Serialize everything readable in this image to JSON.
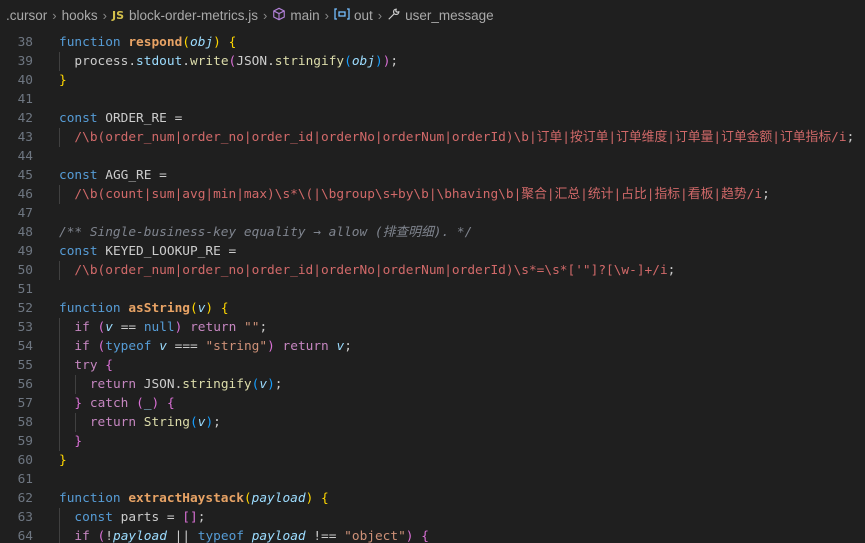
{
  "breadcrumb": {
    "folder": ".cursor",
    "subfolder": "hooks",
    "file_badge": "JS",
    "file": "block-order-metrics.js",
    "symbol1": "main",
    "symbol2": "out",
    "symbol3": "user_message"
  },
  "lines": [
    {
      "n": "38",
      "tokens": [
        [
          "k",
          "function "
        ],
        [
          "bold-fn",
          "respond"
        ],
        [
          "y",
          "("
        ],
        [
          "p",
          "obj"
        ],
        [
          "y",
          ")"
        ],
        [
          "w",
          " "
        ],
        [
          "y",
          "{"
        ]
      ]
    },
    {
      "n": "39",
      "tokens": [
        [
          "w",
          "  process."
        ],
        [
          "v",
          "stdout"
        ],
        [
          "w",
          "."
        ],
        [
          "f",
          "write"
        ],
        [
          "pk",
          "("
        ],
        [
          "w",
          "JSON."
        ],
        [
          "f",
          "stringify"
        ],
        [
          "bl",
          "("
        ],
        [
          "p",
          "obj"
        ],
        [
          "bl",
          ")"
        ],
        [
          "pk",
          ")"
        ],
        [
          "w",
          ";"
        ]
      ]
    },
    {
      "n": "40",
      "tokens": [
        [
          "y",
          "}"
        ]
      ]
    },
    {
      "n": "41",
      "tokens": []
    },
    {
      "n": "42",
      "tokens": [
        [
          "k",
          "const "
        ],
        [
          "w",
          "ORDER_RE ="
        ]
      ]
    },
    {
      "n": "43",
      "tokens": [
        [
          "w",
          "  "
        ],
        [
          "r",
          "/\\b(order_num|order_no|order_id|orderNo|orderNum|orderId)\\b|订单|按订单|订单维度|订单量|订单金额|订单指标/i"
        ],
        [
          "w",
          ";"
        ]
      ]
    },
    {
      "n": "44",
      "tokens": []
    },
    {
      "n": "45",
      "tokens": [
        [
          "k",
          "const "
        ],
        [
          "w",
          "AGG_RE ="
        ]
      ]
    },
    {
      "n": "46",
      "tokens": [
        [
          "w",
          "  "
        ],
        [
          "r",
          "/\\b(count|sum|avg|min|max)\\s*\\(|\\bgroup\\s+by\\b|\\bhaving\\b|聚合|汇总|统计|占比|指标|看板|趋势/i"
        ],
        [
          "w",
          ";"
        ]
      ]
    },
    {
      "n": "47",
      "tokens": []
    },
    {
      "n": "48",
      "tokens": [
        [
          "cm2",
          "/** Single-business-key equality → allow (排查明细). */"
        ]
      ]
    },
    {
      "n": "49",
      "tokens": [
        [
          "k",
          "const "
        ],
        [
          "w",
          "KEYED_LOOKUP_RE ="
        ]
      ]
    },
    {
      "n": "50",
      "tokens": [
        [
          "w",
          "  "
        ],
        [
          "r",
          "/\\b(order_num|order_no|order_id|orderNo|orderNum|orderId)\\s*=\\s*['\"]?[\\w-]+/i"
        ],
        [
          "w",
          ";"
        ]
      ]
    },
    {
      "n": "51",
      "tokens": []
    },
    {
      "n": "52",
      "tokens": [
        [
          "k",
          "function "
        ],
        [
          "bold-fn",
          "asString"
        ],
        [
          "y",
          "("
        ],
        [
          "p",
          "v"
        ],
        [
          "y",
          ")"
        ],
        [
          "w",
          " "
        ],
        [
          "y",
          "{"
        ]
      ]
    },
    {
      "n": "53",
      "tokens": [
        [
          "w",
          "  "
        ],
        [
          "c",
          "if "
        ],
        [
          "pk",
          "("
        ],
        [
          "p",
          "v"
        ],
        [
          "w",
          " == "
        ],
        [
          "k",
          "null"
        ],
        [
          "pk",
          ")"
        ],
        [
          "w",
          " "
        ],
        [
          "c",
          "return "
        ],
        [
          "s",
          "\"\""
        ],
        [
          "w",
          ";"
        ]
      ]
    },
    {
      "n": "54",
      "tokens": [
        [
          "w",
          "  "
        ],
        [
          "c",
          "if "
        ],
        [
          "pk",
          "("
        ],
        [
          "k",
          "typeof "
        ],
        [
          "p",
          "v"
        ],
        [
          "w",
          " === "
        ],
        [
          "s",
          "\"string\""
        ],
        [
          "pk",
          ")"
        ],
        [
          "w",
          " "
        ],
        [
          "c",
          "return "
        ],
        [
          "p",
          "v"
        ],
        [
          "w",
          ";"
        ]
      ]
    },
    {
      "n": "55",
      "tokens": [
        [
          "w",
          "  "
        ],
        [
          "c",
          "try "
        ],
        [
          "pk",
          "{"
        ]
      ]
    },
    {
      "n": "56",
      "tokens": [
        [
          "w",
          "    "
        ],
        [
          "c",
          "return "
        ],
        [
          "w",
          "JSON."
        ],
        [
          "f",
          "stringify"
        ],
        [
          "bl",
          "("
        ],
        [
          "p",
          "v"
        ],
        [
          "bl",
          ")"
        ],
        [
          "w",
          ";"
        ]
      ]
    },
    {
      "n": "57",
      "tokens": [
        [
          "w",
          "  "
        ],
        [
          "pk",
          "}"
        ],
        [
          "w",
          " "
        ],
        [
          "c",
          "catch "
        ],
        [
          "pk",
          "("
        ],
        [
          "p",
          "_"
        ],
        [
          "pk",
          ")"
        ],
        [
          "w",
          " "
        ],
        [
          "pk",
          "{"
        ]
      ]
    },
    {
      "n": "58",
      "tokens": [
        [
          "w",
          "    "
        ],
        [
          "c",
          "return "
        ],
        [
          "f",
          "String"
        ],
        [
          "bl",
          "("
        ],
        [
          "p",
          "v"
        ],
        [
          "bl",
          ")"
        ],
        [
          "w",
          ";"
        ]
      ]
    },
    {
      "n": "59",
      "tokens": [
        [
          "w",
          "  "
        ],
        [
          "pk",
          "}"
        ]
      ]
    },
    {
      "n": "60",
      "tokens": [
        [
          "y",
          "}"
        ]
      ]
    },
    {
      "n": "61",
      "tokens": []
    },
    {
      "n": "62",
      "tokens": [
        [
          "k",
          "function "
        ],
        [
          "bold-fn",
          "extractHaystack"
        ],
        [
          "y",
          "("
        ],
        [
          "p",
          "payload"
        ],
        [
          "y",
          ")"
        ],
        [
          "w",
          " "
        ],
        [
          "y",
          "{"
        ]
      ]
    },
    {
      "n": "63",
      "tokens": [
        [
          "w",
          "  "
        ],
        [
          "k",
          "const "
        ],
        [
          "w",
          "parts = "
        ],
        [
          "pk",
          "[]"
        ],
        [
          "w",
          ";"
        ]
      ]
    },
    {
      "n": "64",
      "tokens": [
        [
          "w",
          "  "
        ],
        [
          "c",
          "if "
        ],
        [
          "pk",
          "("
        ],
        [
          "w",
          "!"
        ],
        [
          "p",
          "payload"
        ],
        [
          "w",
          " || "
        ],
        [
          "k",
          "typeof "
        ],
        [
          "p",
          "payload"
        ],
        [
          "w",
          " !== "
        ],
        [
          "s",
          "\"object\""
        ],
        [
          "pk",
          ")"
        ],
        [
          "w",
          " "
        ],
        [
          "pk",
          "{"
        ]
      ]
    }
  ]
}
